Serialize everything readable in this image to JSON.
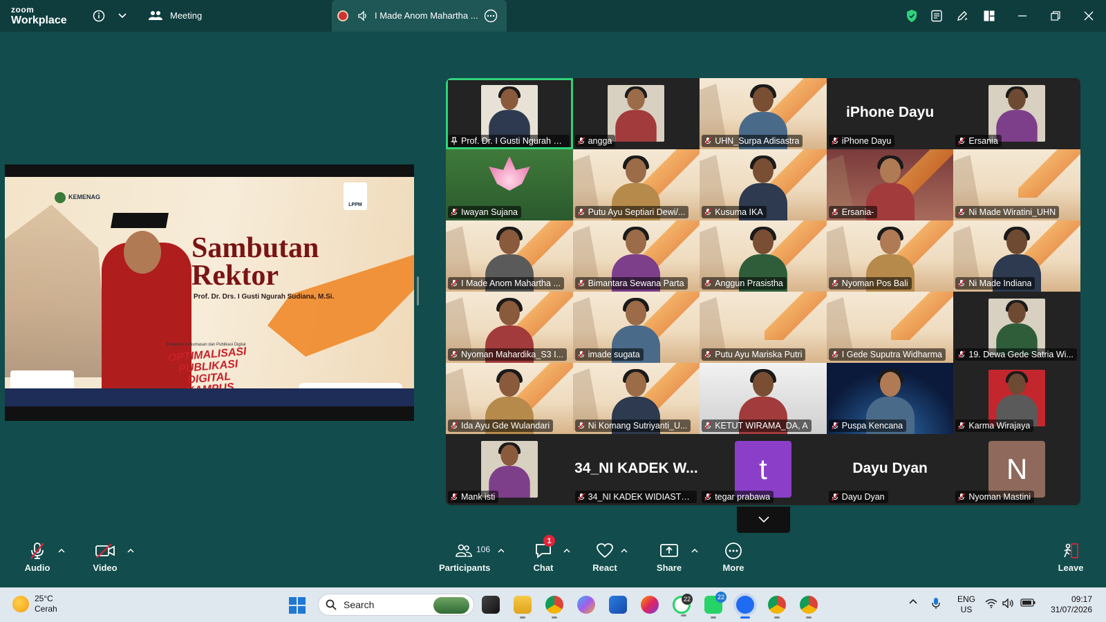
{
  "app": {
    "brand_line1": "zoom",
    "brand_line2": "Workplace",
    "meeting_label": "Meeting",
    "active_tab_title": "I Made Anom Mahartha ...",
    "accent_green": "#2fd37a",
    "background": "#124c4c"
  },
  "shared_slide": {
    "heading_line1": "Sambutan",
    "heading_line2": "Rektor",
    "subtitle": "Prof. Dr. Drs. I Gusti Ngurah Sudiana, M.Si.",
    "org": "KEMENAG",
    "logo_text": "LPPM",
    "event_title_line1": "OPTIMALISASI",
    "event_title_line2": "PUBLIKASI DIGITAL",
    "event_title_line3": "KAMPUS",
    "event_kicker": "Pelatihan Kehumasan dan Publikasi Digital"
  },
  "gallery": {
    "participants": [
      {
        "name": "Prof. Dr. I Gusti Ngurah S...",
        "kind": "framed",
        "pinned": true,
        "active": true
      },
      {
        "name": "angga",
        "kind": "framed"
      },
      {
        "name": "UHN_Surpa Adisastra",
        "kind": "video"
      },
      {
        "name": "iPhone Dayu",
        "kind": "name-only",
        "big": "iPhone Dayu"
      },
      {
        "name": "Ersania",
        "kind": "framed"
      },
      {
        "name": "Iwayan Sujana",
        "kind": "lotus"
      },
      {
        "name": "Putu Ayu Septiari Dewi/...",
        "kind": "video"
      },
      {
        "name": "Kusuma IKA",
        "kind": "video"
      },
      {
        "name": "Ersania-",
        "kind": "video-plain"
      },
      {
        "name": "Ni Made Wiratini_UHN",
        "kind": "video-empty"
      },
      {
        "name": "I Made Anom Mahartha ...",
        "kind": "video"
      },
      {
        "name": "Bimantara Sewana Parta",
        "kind": "video"
      },
      {
        "name": "Anggun Prasistha",
        "kind": "video"
      },
      {
        "name": "Nyoman Pos Bali",
        "kind": "video"
      },
      {
        "name": "Ni Made Indiana",
        "kind": "video"
      },
      {
        "name": "Nyoman Mahardika_S3 I...",
        "kind": "video"
      },
      {
        "name": "imade sugata",
        "kind": "video"
      },
      {
        "name": "Putu Ayu Mariska Putri",
        "kind": "video-empty"
      },
      {
        "name": "I Gede Suputra Widharma",
        "kind": "video-empty"
      },
      {
        "name": "19. Dewa Gede Satria Wi...",
        "kind": "framed"
      },
      {
        "name": "Ida Ayu Gde Wulandari",
        "kind": "video"
      },
      {
        "name": "Ni Komang Sutriyanti_U...",
        "kind": "video"
      },
      {
        "name": "KETUT WIRAMA_DA, A",
        "kind": "room"
      },
      {
        "name": "Puspa Kencana",
        "kind": "space"
      },
      {
        "name": "Karma Wirajaya",
        "kind": "framed"
      },
      {
        "name": "Mank isti",
        "kind": "framed"
      },
      {
        "name": "34_NI KADEK WIDIASTUTI",
        "kind": "name-only",
        "big": "34_NI KADEK W..."
      },
      {
        "name": "tegar prabawa",
        "kind": "letter",
        "letter": "t",
        "color": "#8b3fc9"
      },
      {
        "name": "Dayu Dyan",
        "kind": "name-only",
        "big": "Dayu Dyan"
      },
      {
        "name": "Nyoman Mastini",
        "kind": "letter",
        "letter": "N",
        "color": "#8f6a5c"
      }
    ]
  },
  "toolbar": {
    "audio": "Audio",
    "video": "Video",
    "participants": "Participants",
    "participants_count": "106",
    "chat": "Chat",
    "chat_badge": "1",
    "react": "React",
    "share": "Share",
    "more": "More",
    "leave": "Leave"
  },
  "taskbar": {
    "temp": "25°C",
    "weather": "Cerah",
    "search_placeholder": "Search",
    "whatsapp_badge_1": "22",
    "whatsapp_badge_2": "22",
    "lang_1": "ENG",
    "lang_2": "US",
    "time": "09:17",
    "date": "31/07/2026"
  }
}
